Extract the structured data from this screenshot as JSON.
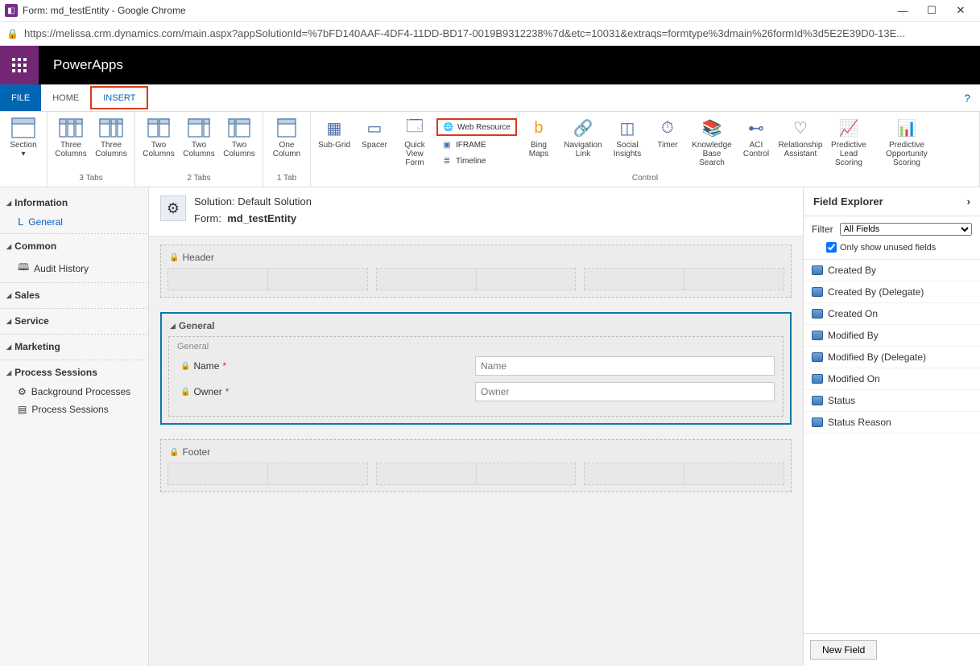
{
  "window": {
    "title": "Form: md_testEntity - Google Chrome"
  },
  "url": "https://melissa.crm.dynamics.com/main.aspx?appSolutionId=%7bFD140AAF-4DF4-11DD-BD17-0019B9312238%7d&etc=10031&extraqs=formtype%3dmain%26formId%3d5E2E39D0-13E...",
  "app": {
    "name": "PowerApps"
  },
  "tabs": {
    "file": "FILE",
    "home": "HOME",
    "insert": "INSERT"
  },
  "ribbon": {
    "section": "Section",
    "three_cols_a": "Three Columns",
    "three_cols_b": "Three Columns",
    "two_cols_a": "Two Columns",
    "two_cols_b": "Two Columns",
    "two_cols_c": "Two Columns",
    "one_col": "One Column",
    "g3": "3 Tabs",
    "g2": "2 Tabs",
    "g1": "1 Tab",
    "subgrid": "Sub-Grid",
    "spacer": "Spacer",
    "qview": "Quick View Form",
    "webres": "Web Resource",
    "iframe": "IFRAME",
    "timeline": "Timeline",
    "bing": "Bing Maps",
    "navlink": "Navigation Link",
    "social": "Social Insights",
    "timer": "Timer",
    "kb": "Knowledge Base Search",
    "aci": "ACI Control",
    "ra": "Relationship Assistant",
    "pls": "Predictive Lead Scoring",
    "pos": "Predictive Opportunity Scoring",
    "gcontrol": "Control"
  },
  "nav": {
    "information": "Information",
    "general": "General",
    "common": "Common",
    "audit": "Audit History",
    "sales": "Sales",
    "service": "Service",
    "marketing": "Marketing",
    "ps": "Process Sessions",
    "bgp": "Background Processes",
    "psitem": "Process Sessions"
  },
  "canvas": {
    "solution_lbl": "Solution:",
    "solution": "Default Solution",
    "form_lbl": "Form:",
    "form": "md_testEntity",
    "header": "Header",
    "footer": "Footer",
    "general": "General",
    "general_sub": "General",
    "name_lbl": "Name",
    "name_ph": "Name",
    "owner_lbl": "Owner",
    "owner_ph": "Owner"
  },
  "explorer": {
    "title": "Field Explorer",
    "filter_lbl": "Filter",
    "filter_val": "All Fields",
    "only_unused": "Only show unused fields",
    "items": [
      "Created By",
      "Created By (Delegate)",
      "Created On",
      "Modified By",
      "Modified By (Delegate)",
      "Modified On",
      "Status",
      "Status Reason"
    ],
    "newfield": "New Field"
  }
}
